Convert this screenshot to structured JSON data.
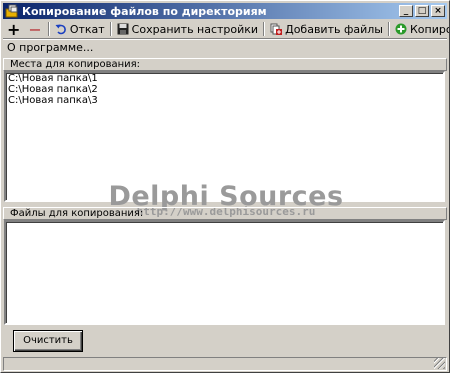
{
  "window": {
    "title": "Копирование файлов по директориям",
    "minimize": "_",
    "maximize": "□",
    "close": "×"
  },
  "toolbar": {
    "add": "+",
    "remove": "−",
    "undo_label": "Откат",
    "save_label": "Сохранить настройки",
    "add_files_label": "Добавить файлы",
    "copy_files_label": "Копировать файлы"
  },
  "menu": {
    "about": "О программе..."
  },
  "destinations": {
    "header": "Места для копирования:",
    "items": [
      "C:\\Новая папка\\1",
      "C:\\Новая папка\\2",
      "C:\\Новая папка\\3"
    ]
  },
  "watermark": {
    "title": "Delphi Sources",
    "url": "http://www.delphisources.ru"
  },
  "files": {
    "header": "Файлы для копирования:",
    "items": []
  },
  "buttons": {
    "clear_label": "Очистить"
  },
  "colors": {
    "titlebar_start": "#0a246a",
    "titlebar_end": "#a6caf0",
    "face": "#d4d0c8"
  }
}
